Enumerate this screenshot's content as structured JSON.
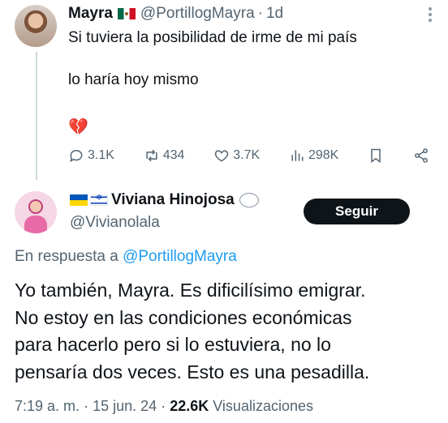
{
  "parent_tweet": {
    "name": "Mayra",
    "handle": "@PortillogMayra",
    "separator": "·",
    "time": "1d",
    "text_line1": "Si tuviera la posibilidad de irme de mi país",
    "text_line2": "lo haría hoy mismo",
    "emoji": "💔",
    "stats": {
      "replies": "3.1K",
      "reposts": "434",
      "likes": "3.7K",
      "views": "298K"
    },
    "icons": [
      "comment-icon",
      "repost-icon",
      "heart-icon",
      "views-icon",
      "bookmark-icon",
      "share-icon"
    ]
  },
  "reply_tweet": {
    "name": "Viviana Hinojosa",
    "handle": "@Vivianolala",
    "follow_label": "Seguir",
    "in_reply_prefix": "En respuesta a ",
    "in_reply_handle": "@PortillogMayra",
    "text_lines": [
      "Yo también, Mayra. Es dificilísimo emigrar.",
      "No estoy en las condiciones económicas",
      "para hacerlo pero si lo estuviera, no lo",
      "pensaría dos veces. Esto es una pesadilla."
    ],
    "time": "7:19 a. m.",
    "dot1": "·",
    "date": "15 jun. 24",
    "dot2": "·",
    "views_count": "22.6K",
    "views_label": "Visualizaciones"
  },
  "colors": {
    "accent": "#1d9bf0",
    "text": "#0f1419",
    "muted": "#536471",
    "button_bg": "#0f1419"
  }
}
